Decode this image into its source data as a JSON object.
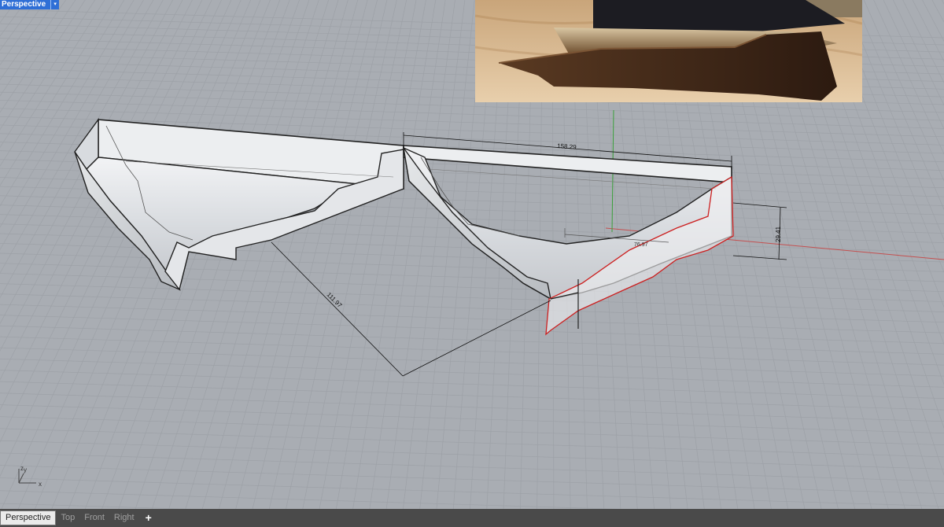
{
  "viewport": {
    "label": "Perspective",
    "menu_arrow": "▾"
  },
  "dimensions": {
    "length": "158.29",
    "width": "111.97",
    "height": "29.41",
    "inner": "76.97"
  },
  "axis_gizmo": {
    "x": "x",
    "y": "y",
    "z": "z"
  },
  "tabs": [
    {
      "label": "Perspective",
      "active": true
    },
    {
      "label": "Top",
      "active": false
    },
    {
      "label": "Front",
      "active": false
    },
    {
      "label": "Right",
      "active": false
    }
  ],
  "add_tab": "+",
  "colors": {
    "background": "#a9adb3",
    "grid": "#9fa3a9",
    "selection": "#cc2020",
    "label_bg": "#2f6fd6",
    "x_axis": "#c04040",
    "y_axis": "#30a030"
  },
  "reference_image": "photo-of-wooden-cornice-moulding-sample"
}
